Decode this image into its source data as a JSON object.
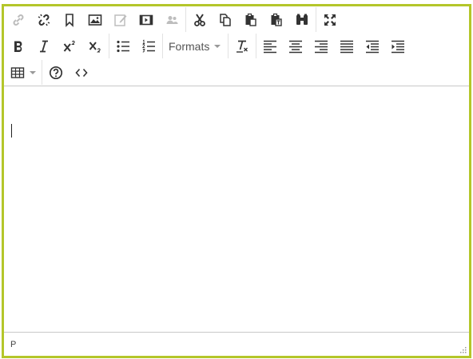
{
  "toolbar": {
    "rows": [
      [
        [
          {
            "name": "link-icon",
            "disabled": true
          },
          {
            "name": "unlink-icon",
            "disabled": false
          },
          {
            "name": "bookmark-icon",
            "disabled": false
          },
          {
            "name": "image-icon",
            "disabled": false
          },
          {
            "name": "edit-icon",
            "disabled": true
          },
          {
            "name": "media-icon",
            "disabled": false
          },
          {
            "name": "users-icon",
            "disabled": true
          }
        ],
        [
          {
            "name": "cut-icon",
            "disabled": false
          },
          {
            "name": "copy-icon",
            "disabled": false
          },
          {
            "name": "paste-icon",
            "disabled": false
          },
          {
            "name": "paste-text-icon",
            "disabled": false
          },
          {
            "name": "find-icon",
            "disabled": false
          }
        ],
        [
          {
            "name": "fullscreen-icon",
            "disabled": false
          }
        ]
      ],
      [
        [
          {
            "name": "bold-icon",
            "text": "B"
          },
          {
            "name": "italic-icon",
            "text": "I"
          },
          {
            "name": "superscript-icon"
          },
          {
            "name": "subscript-icon"
          }
        ],
        [
          {
            "name": "bullet-list-icon"
          },
          {
            "name": "numbered-list-icon"
          }
        ],
        [
          {
            "name": "formats-dropdown",
            "label": "Formats"
          }
        ],
        [
          {
            "name": "clear-formatting-icon"
          }
        ],
        [
          {
            "name": "align-left-icon"
          },
          {
            "name": "align-center-icon"
          },
          {
            "name": "align-right-icon"
          },
          {
            "name": "align-justify-icon"
          },
          {
            "name": "outdent-icon"
          },
          {
            "name": "indent-icon"
          }
        ]
      ],
      [
        [
          {
            "name": "table-icon"
          }
        ],
        [
          {
            "name": "help-icon"
          },
          {
            "name": "source-code-icon"
          }
        ]
      ]
    ]
  },
  "formats": {
    "label": "Formats"
  },
  "statusbar": {
    "path": "P"
  },
  "colors": {
    "border": "#b4c62a",
    "icon": "#333333",
    "disabled_icon": "#bdbdbd"
  }
}
